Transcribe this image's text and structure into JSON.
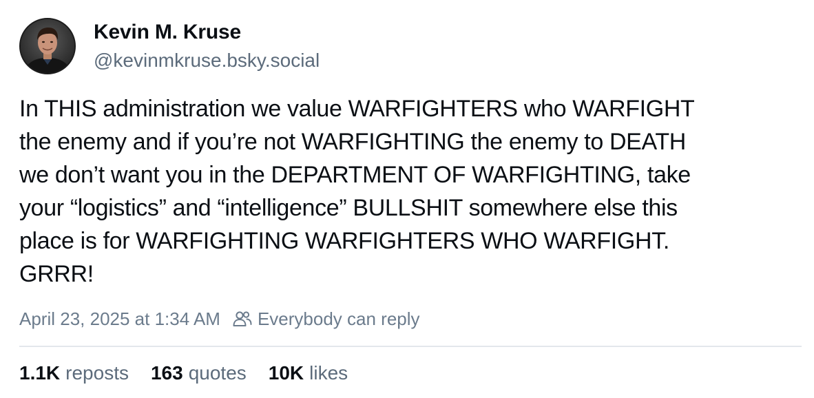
{
  "author": {
    "display_name": "Kevin M. Kruse",
    "handle": "@kevinmkruse.bsky.social"
  },
  "post": {
    "text": "In THIS administration we value WARFIGHTERS who WARFIGHT\nthe enemy and if you’re not WARFIGHTING the enemy to DEATH\nwe don’t want you in the DEPARTMENT OF WARFIGHTING, take\nyour “logistics” and “intelligence” BULLSHIT somewhere else this\nplace is for WARFIGHTING WARFIGHTERS WHO WARFIGHT.\nGRRR!",
    "timestamp": "April 23, 2025 at 1:34 AM",
    "reply_setting": "Everybody can reply",
    "reply_icon": "people-icon"
  },
  "stats": {
    "reposts": {
      "count": "1.1K",
      "label": "reposts"
    },
    "quotes": {
      "count": "163",
      "label": "quotes"
    },
    "likes": {
      "count": "10K",
      "label": "likes"
    }
  },
  "colors": {
    "text": "#0b0f14",
    "secondary": "#5c6b7b",
    "meta": "#6b7b8c",
    "divider": "#e3e7ec"
  }
}
